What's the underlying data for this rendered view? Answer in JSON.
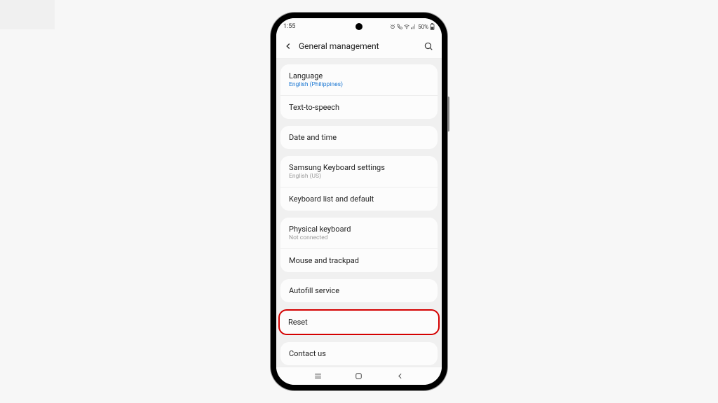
{
  "status": {
    "time": "1:55",
    "battery": "50%"
  },
  "header": {
    "title": "General management"
  },
  "groups": [
    {
      "items": [
        {
          "title": "Language",
          "sub": "English (Philippines)",
          "subStyle": "blue",
          "name": "language"
        },
        {
          "title": "Text-to-speech",
          "name": "text-to-speech"
        }
      ]
    },
    {
      "items": [
        {
          "title": "Date and time",
          "name": "date-and-time"
        }
      ]
    },
    {
      "items": [
        {
          "title": "Samsung Keyboard settings",
          "sub": "English (US)",
          "subStyle": "gray",
          "name": "samsung-keyboard"
        },
        {
          "title": "Keyboard list and default",
          "name": "keyboard-list"
        }
      ]
    },
    {
      "items": [
        {
          "title": "Physical keyboard",
          "sub": "Not connected",
          "subStyle": "gray",
          "name": "physical-keyboard"
        },
        {
          "title": "Mouse and trackpad",
          "name": "mouse-trackpad"
        }
      ]
    },
    {
      "items": [
        {
          "title": "Autofill service",
          "name": "autofill-service"
        }
      ]
    },
    {
      "highlight": true,
      "items": [
        {
          "title": "Reset",
          "name": "reset"
        }
      ]
    },
    {
      "items": [
        {
          "title": "Contact us",
          "name": "contact-us"
        }
      ]
    }
  ]
}
